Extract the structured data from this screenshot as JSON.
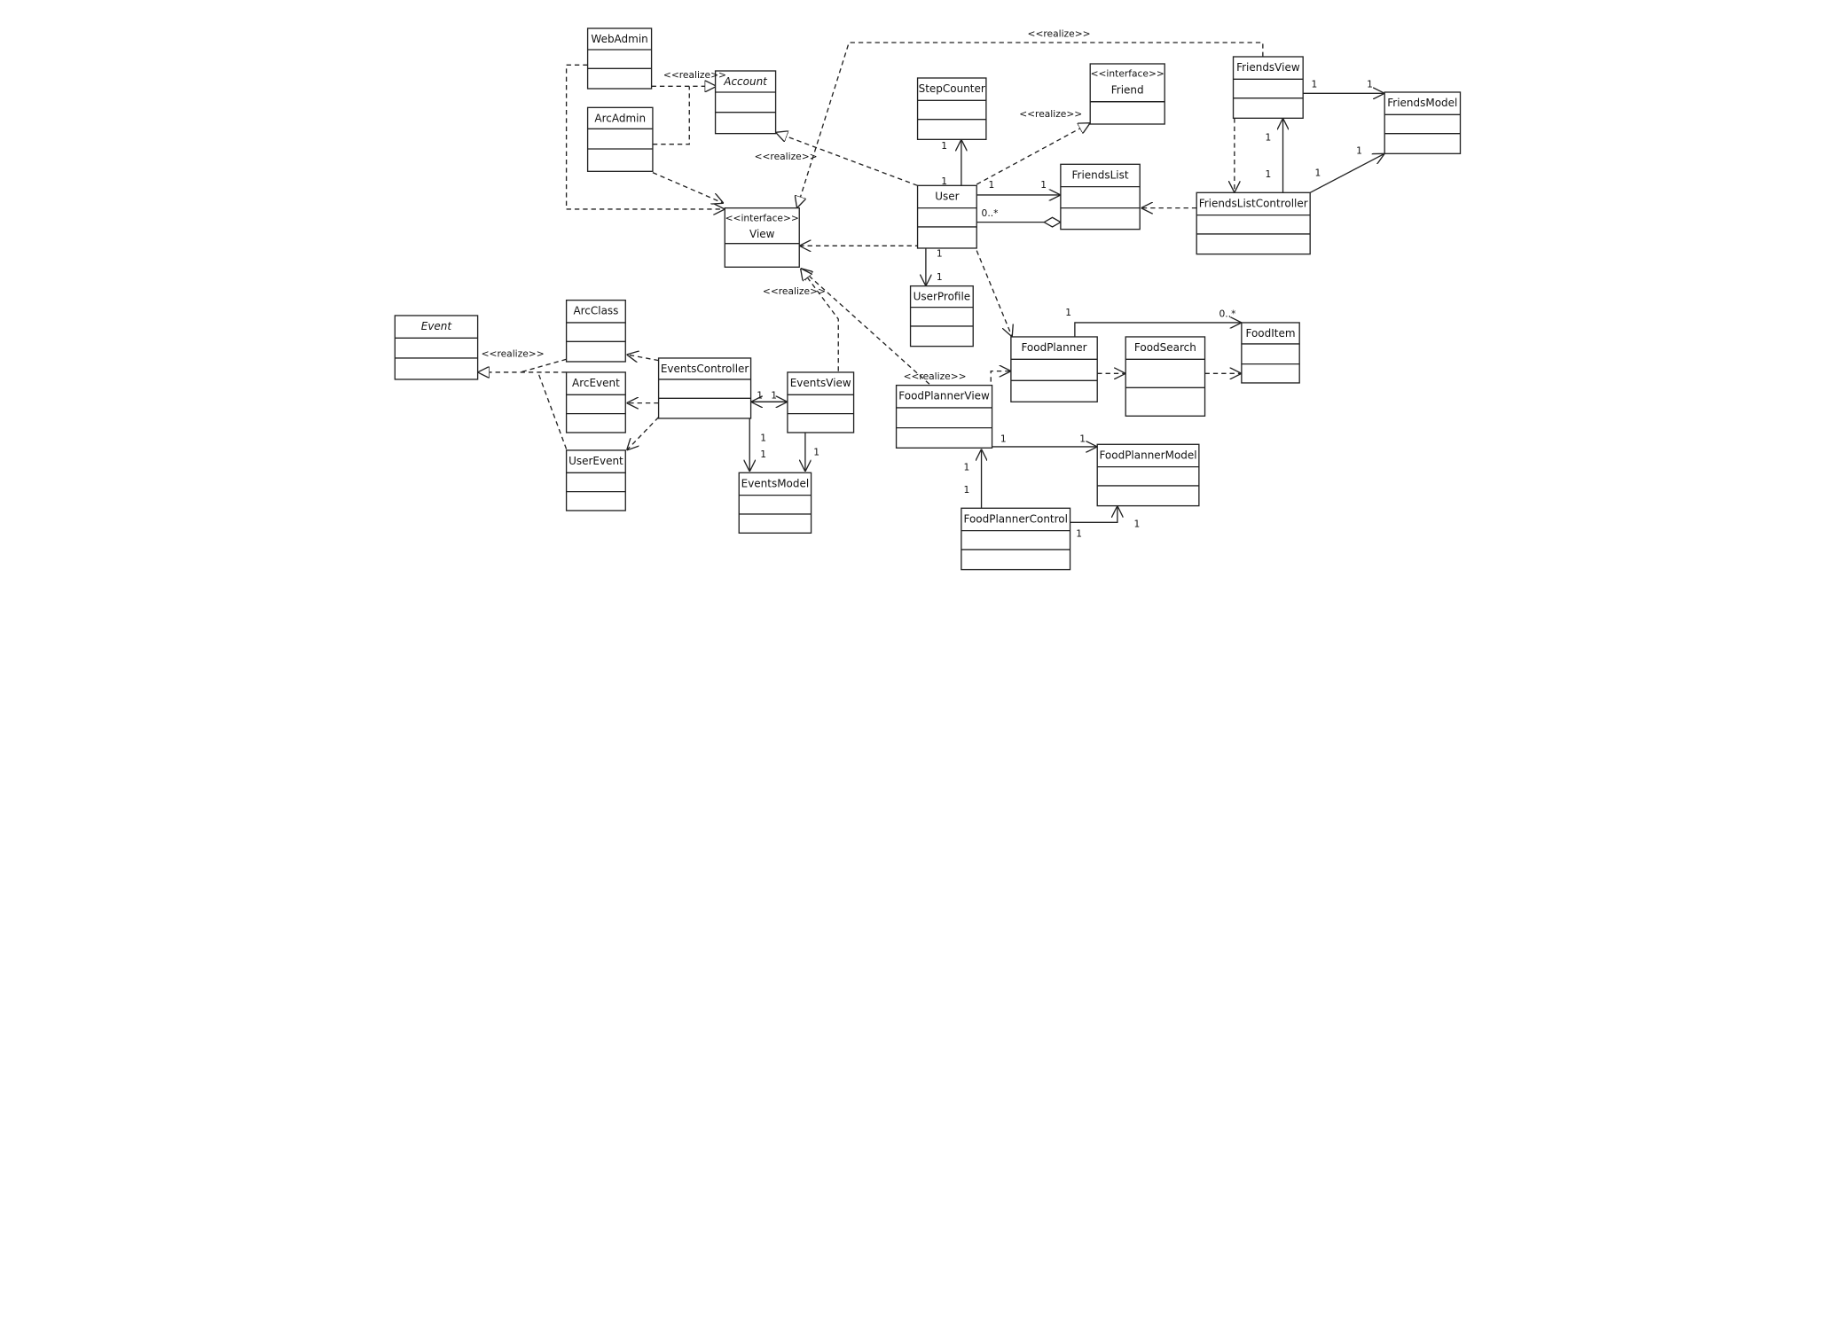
{
  "diagram": {
    "classes": [
      {
        "id": "webadmin",
        "name": "WebAdmin"
      },
      {
        "id": "arcadmin",
        "name": "ArcAdmin"
      },
      {
        "id": "account",
        "name": "Account",
        "abstract": true
      },
      {
        "id": "view",
        "name": "View",
        "stereotype": "<<interface>>"
      },
      {
        "id": "stepcounter",
        "name": "StepCounter"
      },
      {
        "id": "friend",
        "name": "Friend",
        "stereotype": "<<interface>>"
      },
      {
        "id": "user",
        "name": "User"
      },
      {
        "id": "friendslist",
        "name": "FriendsList"
      },
      {
        "id": "friendsview",
        "name": "FriendsView"
      },
      {
        "id": "friendsmodel",
        "name": "FriendsModel"
      },
      {
        "id": "friendslistcontroller",
        "name": "FriendsListController"
      },
      {
        "id": "userprofile",
        "name": "UserProfile"
      },
      {
        "id": "foodplanner",
        "name": "FoodPlanner"
      },
      {
        "id": "foodsearch",
        "name": "FoodSearch"
      },
      {
        "id": "fooditem",
        "name": "FoodItem"
      },
      {
        "id": "event",
        "name": "Event",
        "abstract": true
      },
      {
        "id": "arcclass",
        "name": "ArcClass"
      },
      {
        "id": "arcevent",
        "name": "ArcEvent"
      },
      {
        "id": "userevent",
        "name": "UserEvent"
      },
      {
        "id": "eventscontroller",
        "name": "EventsController"
      },
      {
        "id": "eventsview",
        "name": "EventsView"
      },
      {
        "id": "eventsmodel",
        "name": "EventsModel"
      },
      {
        "id": "foodplannerview",
        "name": "FoodPlannerView"
      },
      {
        "id": "foodplannermodel",
        "name": "FoodPlannerModel"
      },
      {
        "id": "foodplannercontrol",
        "name": "FoodPlannerControl"
      }
    ],
    "realize_label": "<<realize>>",
    "multiplicities": {
      "user_stepcounter_near_user": "1",
      "user_stepcounter_near_step": "1",
      "user_friendslist_near_user": "1",
      "user_friendslist_near_list": "1",
      "user_friendslist_agg": "0..*",
      "user_profile_near_user": "1",
      "user_profile_near_profile": "1",
      "friendsview_model_near_view": "1",
      "friendsview_model_near_model": "1",
      "controller_view_near_ctrl": "1",
      "controller_view_near_view": "1",
      "controller_model": "1",
      "foodplanner_item_near_planner": "1",
      "foodplanner_item_near_item": "0..*",
      "eventscontroller_view_a": "1",
      "eventscontroller_view_b": "1",
      "eventscontroller_model_a": "1",
      "eventscontroller_model_b": "1",
      "eventsview_model": "1",
      "fpview_model_near_view": "1",
      "fpview_model_near_model": "1",
      "fpcontrol_view_a": "1",
      "fpcontrol_view_b": "1",
      "fpcontrol_model_a": "1",
      "fpcontrol_model_b": "1"
    }
  }
}
